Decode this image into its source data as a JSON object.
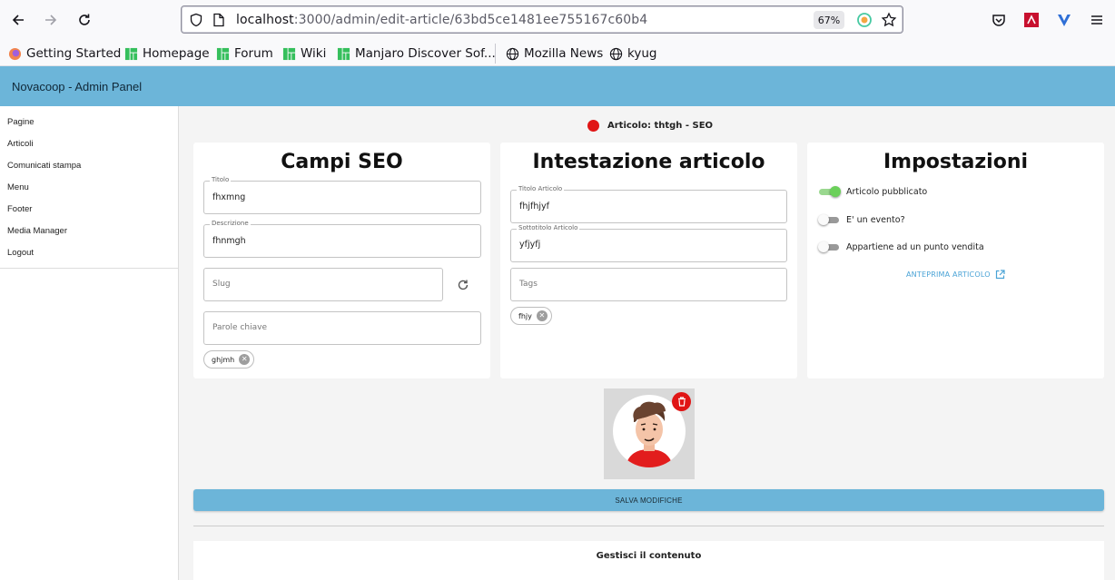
{
  "browser": {
    "url_host": "localhost",
    "url_path": ":3000/admin/edit-article/63bd5ce1481ee755167c60b4",
    "zoom": "67%",
    "bookmarks": [
      "Getting Started",
      "Homepage",
      "Forum",
      "Wiki",
      "Manjaro Discover Sof...",
      "Mozilla News",
      "kyug"
    ]
  },
  "app": {
    "title": "Novacoop - Admin Panel"
  },
  "sidebar": {
    "items": [
      "Pagine",
      "Articoli",
      "Comunicati stampa",
      "Menu",
      "Footer",
      "Media Manager",
      "Logout"
    ]
  },
  "header": {
    "article_label": "Articolo: thtgh - SEO",
    "status_color": "#e01515"
  },
  "seo": {
    "title": "Campi SEO",
    "titolo_label": "Titolo",
    "titolo_value": "fhxmng",
    "descrizione_label": "Descrizione",
    "descrizione_value": "fhnmgh",
    "slug_placeholder": "Slug",
    "keywords_placeholder": "Parole chiave",
    "keyword_chip": "ghjmh"
  },
  "intestazione": {
    "title": "Intestazione articolo",
    "titolo_label": "Titolo Articolo",
    "titolo_value": "fhjfhjyf",
    "sottotitolo_label": "Sottotitolo Articolo",
    "sottotitolo_value": "yfjyfj",
    "tags_placeholder": "Tags",
    "tag_chip": "fhjy"
  },
  "impostazioni": {
    "title": "Impostazioni",
    "switches": [
      {
        "label": "Articolo pubblicato",
        "on": true
      },
      {
        "label": "E' un evento?",
        "on": false
      },
      {
        "label": "Appartiene ad un punto vendita",
        "on": false
      }
    ],
    "preview_link": "ANTEPRIMA ARTICOLO"
  },
  "actions": {
    "save_label": "SALVA MODIFICHE"
  },
  "content": {
    "title": "Gestisci il contenuto"
  },
  "colors": {
    "accent": "#6cb5d9",
    "danger": "#e01515",
    "switch_on": "#6bd05a",
    "link": "#4aa3d6"
  }
}
